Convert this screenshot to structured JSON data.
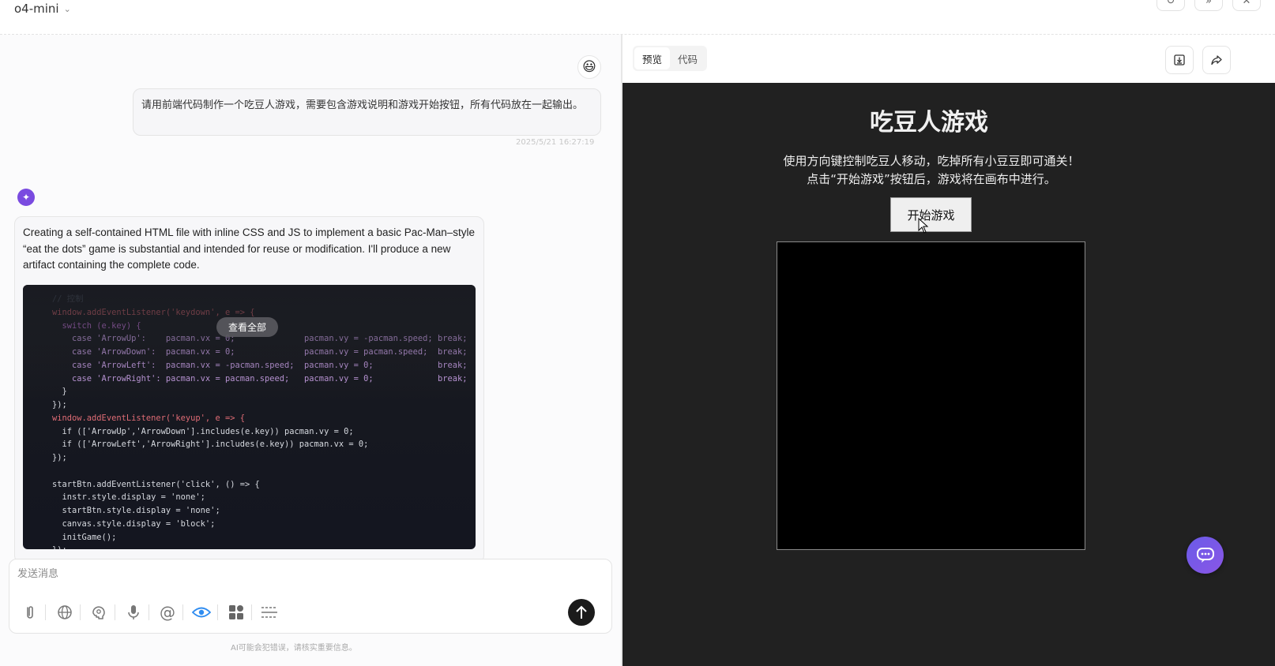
{
  "header": {
    "model_name": "o4-mini",
    "top_actions": [
      "↻",
      "»",
      "✕"
    ]
  },
  "chat": {
    "user_message": "请用前端代码制作一个吃豆人游戏，需要包含游戏说明和游戏开始按钮，所有代码放在一起输出。",
    "user_timestamp": "2025/5/21 16:27:19",
    "assistant_intro": "Creating a self-contained HTML file with inline CSS and JS to implement a basic Pac-Man–style “eat the dots” game is substantial and intended for reuse or modification. I'll produce a new artifact containing the complete code.",
    "view_all_label": "查看全部",
    "code_lines": [
      {
        "text": "// 控制",
        "color": "#5c6370"
      },
      {
        "text": "window.addEventListener('keydown', e => {",
        "color": "#e06c75"
      },
      {
        "text": "  switch (e.key) {",
        "color": "#c678dd"
      },
      {
        "text": "    case 'ArrowUp':    pacman.vx = 0;              pacman.vy = -pacman.speed; break;",
        "color": "#c9a0e6"
      },
      {
        "text": "    case 'ArrowDown':  pacman.vx = 0;              pacman.vy = pacman.speed;  break;",
        "color": "#c9a0e6"
      },
      {
        "text": "    case 'ArrowLeft':  pacman.vx = -pacman.speed;  pacman.vy = 0;             break;",
        "color": "#c9a0e6"
      },
      {
        "text": "    case 'ArrowRight': pacman.vx = pacman.speed;   pacman.vy = 0;             break;",
        "color": "#c9a0e6"
      },
      {
        "text": "  }",
        "color": "#d7dae0"
      },
      {
        "text": "});",
        "color": "#d7dae0"
      },
      {
        "text": "window.addEventListener('keyup', e => {",
        "color": "#e06c75"
      },
      {
        "text": "  if (['ArrowUp','ArrowDown'].includes(e.key)) pacman.vy = 0;",
        "color": "#d7dae0"
      },
      {
        "text": "  if (['ArrowLeft','ArrowRight'].includes(e.key)) pacman.vx = 0;",
        "color": "#d7dae0"
      },
      {
        "text": "});",
        "color": "#d7dae0"
      },
      {
        "text": "",
        "color": "#d7dae0"
      },
      {
        "text": "startBtn.addEventListener('click', () => {",
        "color": "#d7dae0"
      },
      {
        "text": "  instr.style.display = 'none';",
        "color": "#d7dae0"
      },
      {
        "text": "  startBtn.style.display = 'none';",
        "color": "#d7dae0"
      },
      {
        "text": "  canvas.style.display = 'block';",
        "color": "#d7dae0"
      },
      {
        "text": "  initGame();",
        "color": "#d7dae0"
      },
      {
        "text": "});",
        "color": "#d7dae0"
      }
    ],
    "composer_placeholder": "发送消息",
    "disclaimer": "AI可能会犯错误，请核实重要信息。",
    "tools": [
      "paperclip-icon",
      "globe-icon",
      "brain-icon",
      "mic-icon",
      "at-icon",
      "eye-icon",
      "apps-icon",
      "divider-icon"
    ]
  },
  "right_panel": {
    "tabs": [
      "预览",
      "代码"
    ],
    "active_tab": "预览"
  },
  "preview": {
    "title": "吃豆人游戏",
    "instructions_line1": "使用方向键控制吃豆人移动，吃掉所有小豆豆即可通关！",
    "instructions_line2": "点击“开始游戏”按钮后，游戏将在画布中进行。",
    "start_button": "开始游戏"
  },
  "colors": {
    "preview_bg": "#212121",
    "accent_purple": "#7a4be0",
    "eye_active": "#2f8cf0"
  }
}
